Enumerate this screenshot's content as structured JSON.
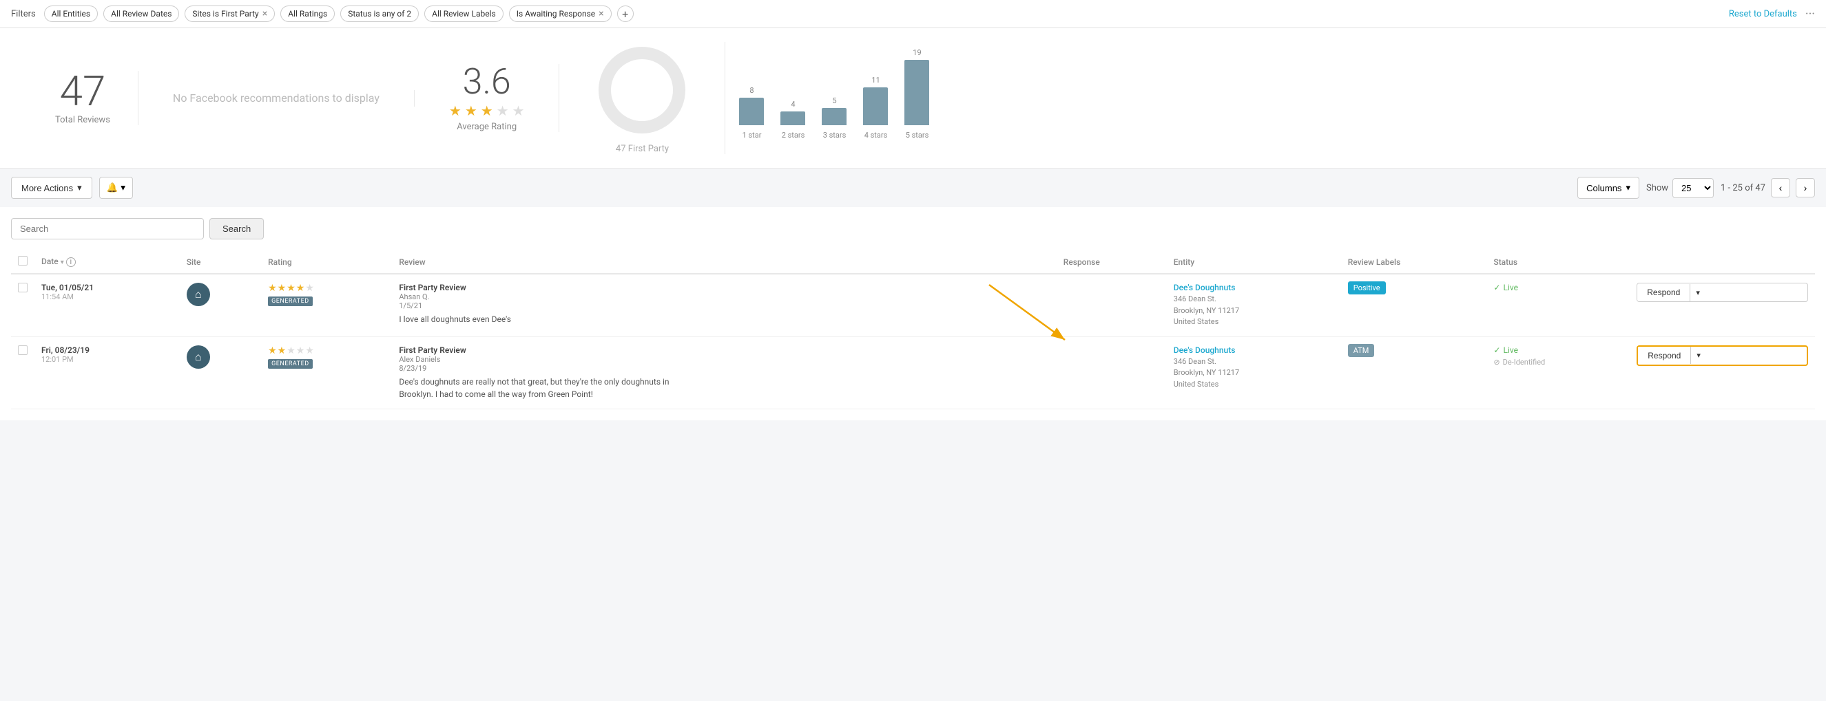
{
  "filters": {
    "label": "Filters",
    "chips": [
      {
        "id": "all-entities",
        "label": "All Entities",
        "removable": false
      },
      {
        "id": "all-review-dates",
        "label": "All Review Dates",
        "removable": false
      },
      {
        "id": "sites-first-party",
        "label": "Sites is First Party",
        "removable": true
      },
      {
        "id": "all-ratings",
        "label": "All Ratings",
        "removable": false
      },
      {
        "id": "status-any-2",
        "label": "Status is any of 2",
        "removable": false
      },
      {
        "id": "all-review-labels",
        "label": "All Review Labels",
        "removable": false
      },
      {
        "id": "awaiting-response",
        "label": "Is Awaiting Response",
        "removable": true
      }
    ],
    "reset_label": "Reset to Defaults",
    "more_label": "..."
  },
  "stats": {
    "total_reviews": "47",
    "total_label": "Total Reviews",
    "facebook_msg": "No Facebook recommendations to display",
    "average_rating": "3.6",
    "rating_label": "Average Rating",
    "full_stars": 3,
    "empty_stars": 2,
    "donut_label": "47 First Party",
    "bars": [
      {
        "label": "1 star",
        "value": 8,
        "height": 40
      },
      {
        "label": "2 stars",
        "value": 4,
        "height": 20
      },
      {
        "label": "3 stars",
        "value": 5,
        "height": 25
      },
      {
        "label": "4 stars",
        "value": 11,
        "height": 55
      },
      {
        "label": "5 stars",
        "value": 19,
        "height": 95
      }
    ]
  },
  "toolbar": {
    "more_actions_label": "More Actions",
    "columns_label": "Columns",
    "show_label": "Show",
    "show_value": "25",
    "pagination_text": "1 - 25 of 47"
  },
  "search": {
    "placeholder": "Search",
    "button_label": "Search"
  },
  "table": {
    "columns": [
      "",
      "Date",
      "",
      "Site",
      "Rating",
      "Review",
      "Response",
      "Entity",
      "Review Labels",
      "Status",
      ""
    ],
    "rows": [
      {
        "id": "row-1",
        "date_main": "Tue, 01/05/21",
        "date_time": "11:54 AM",
        "rating": 4,
        "generated": true,
        "review_title": "First Party Review",
        "review_author": "Ahsan Q.",
        "review_date": "1/5/21",
        "review_text": "I love all doughnuts even Dee's",
        "response": "",
        "entity_name": "Dee's Doughnuts",
        "entity_address": "346 Dean St.\nBrooklyn, NY 11217\nUnited States",
        "label": "Positive",
        "label_type": "positive",
        "status_live": true,
        "status_deidentified": false,
        "highlighted": false
      },
      {
        "id": "row-2",
        "date_main": "Fri, 08/23/19",
        "date_time": "12:01 PM",
        "rating": 2,
        "generated": true,
        "review_title": "First Party Review",
        "review_author": "Alex Daniels",
        "review_date": "8/23/19",
        "review_text": "Dee's doughnuts are really not that great, but they're the only doughnuts in Brooklyn. I had to come all the way from Green Point!",
        "response": "",
        "entity_name": "Dee's Doughnuts",
        "entity_address": "346 Dean St.\nBrooklyn, NY 11217\nUnited States",
        "label": "ATM",
        "label_type": "atm",
        "status_live": true,
        "status_deidentified": true,
        "highlighted": true
      }
    ]
  },
  "icons": {
    "chevron_down": "▾",
    "close": "×",
    "plus": "+",
    "check": "✓",
    "bell": "🔔",
    "home": "⌂",
    "arrow_left": "‹",
    "arrow_right": "›",
    "info": "i",
    "deidentified": "⊘"
  }
}
